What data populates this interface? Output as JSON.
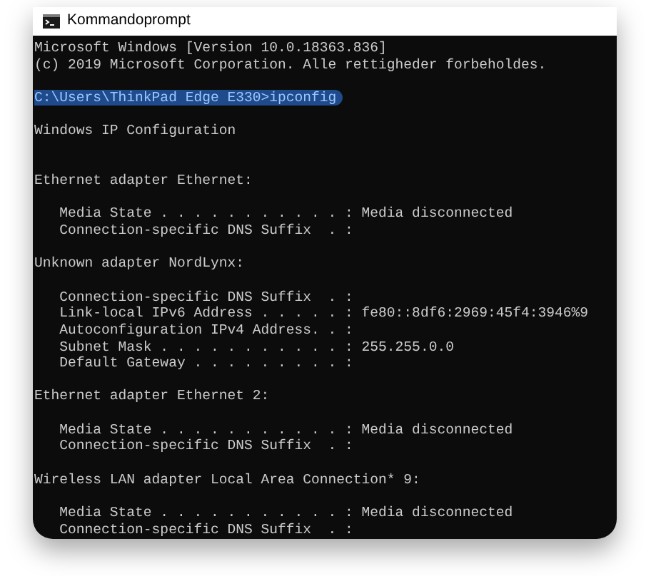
{
  "window": {
    "title": "Kommandoprompt"
  },
  "console": {
    "lines": [
      {
        "kind": "text",
        "text": "Microsoft Windows [Version 10.0.18363.836]",
        "selected": false
      },
      {
        "kind": "text",
        "text": "(c) 2019 Microsoft Corporation. Alle rettigheder forbeholdes.",
        "selected": false
      },
      {
        "kind": "blank"
      },
      {
        "kind": "text",
        "text": "C:\\Users\\ThinkPad Edge E330>ipconfig",
        "selected": true
      },
      {
        "kind": "blank"
      },
      {
        "kind": "text",
        "text": "Windows IP Configuration",
        "selected": false
      },
      {
        "kind": "blank"
      },
      {
        "kind": "blank"
      },
      {
        "kind": "text",
        "text": "Ethernet adapter Ethernet:",
        "selected": false
      },
      {
        "kind": "blank"
      },
      {
        "kind": "text",
        "text": "   Media State . . . . . . . . . . . : Media disconnected",
        "selected": false
      },
      {
        "kind": "text",
        "text": "   Connection-specific DNS Suffix  . :",
        "selected": false
      },
      {
        "kind": "blank"
      },
      {
        "kind": "text",
        "text": "Unknown adapter NordLynx:",
        "selected": false
      },
      {
        "kind": "blank"
      },
      {
        "kind": "text",
        "text": "   Connection-specific DNS Suffix  . :",
        "selected": false
      },
      {
        "kind": "text",
        "text": "   Link-local IPv6 Address . . . . . : fe80::8df6:2969:45f4:3946%9",
        "selected": false
      },
      {
        "kind": "text",
        "text": "   Autoconfiguration IPv4 Address. . :",
        "selected": false
      },
      {
        "kind": "text",
        "text": "   Subnet Mask . . . . . . . . . . . : 255.255.0.0",
        "selected": false
      },
      {
        "kind": "text",
        "text": "   Default Gateway . . . . . . . . . :",
        "selected": false
      },
      {
        "kind": "blank"
      },
      {
        "kind": "text",
        "text": "Ethernet adapter Ethernet 2:",
        "selected": false
      },
      {
        "kind": "blank"
      },
      {
        "kind": "text",
        "text": "   Media State . . . . . . . . . . . : Media disconnected",
        "selected": false
      },
      {
        "kind": "text",
        "text": "   Connection-specific DNS Suffix  . :",
        "selected": false
      },
      {
        "kind": "blank"
      },
      {
        "kind": "text",
        "text": "Wireless LAN adapter Local Area Connection* 9:",
        "selected": false
      },
      {
        "kind": "blank"
      },
      {
        "kind": "text",
        "text": "   Media State . . . . . . . . . . . : Media disconnected",
        "selected": false
      },
      {
        "kind": "text",
        "text": "   Connection-specific DNS Suffix  . :",
        "selected": false
      }
    ]
  }
}
